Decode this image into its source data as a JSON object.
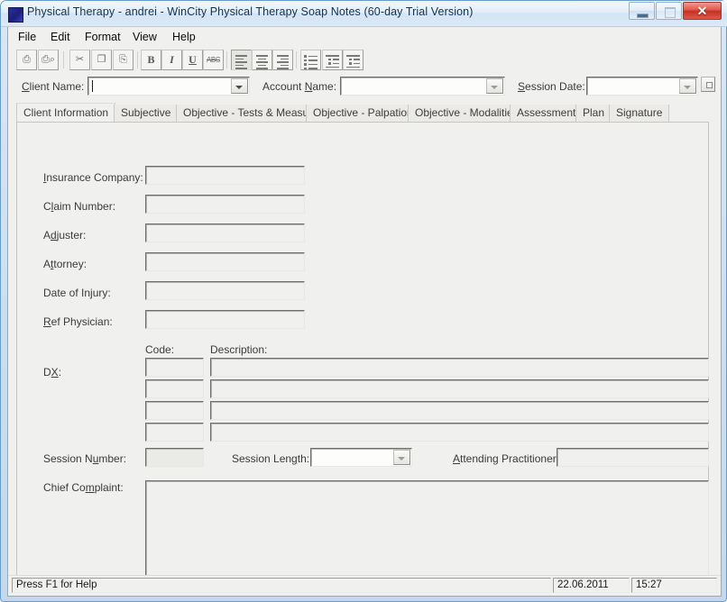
{
  "window": {
    "title": "Physical Therapy - andrei - WinCity Physical Therapy Soap Notes (60-day Trial Version)",
    "icon": "app-icon",
    "controls": {
      "minimize": "minimize-icon",
      "maximize": "maximize-icon",
      "close": "✕"
    }
  },
  "menu": {
    "items": [
      {
        "label": "File"
      },
      {
        "label": "Edit"
      },
      {
        "label": "Format"
      },
      {
        "label": "View"
      },
      {
        "label": "Help"
      }
    ]
  },
  "toolbar": {
    "buttons": [
      {
        "name": "print-icon",
        "glyph": "⎙"
      },
      {
        "name": "print-preview-icon",
        "glyph": "⌕"
      },
      {
        "name": "cut-icon",
        "glyph": "✂"
      },
      {
        "name": "copy-icon",
        "glyph": "❐"
      },
      {
        "name": "paste-icon",
        "glyph": "⎘"
      },
      {
        "name": "bold-icon",
        "glyph": "B"
      },
      {
        "name": "italic-icon",
        "glyph": "I"
      },
      {
        "name": "underline-icon",
        "glyph": "U"
      },
      {
        "name": "spellcheck-icon",
        "glyph": "ABC"
      },
      {
        "name": "align-left-icon",
        "glyph": ""
      },
      {
        "name": "align-center-icon",
        "glyph": ""
      },
      {
        "name": "align-right-icon",
        "glyph": ""
      },
      {
        "name": "bullet-list-icon",
        "glyph": ""
      },
      {
        "name": "decrease-indent-icon",
        "glyph": ""
      },
      {
        "name": "increase-indent-icon",
        "glyph": ""
      }
    ]
  },
  "top_fields": {
    "client_name": {
      "label_pre": "C",
      "label_post": "lient Name:",
      "value": "",
      "placeholder": ""
    },
    "account_name": {
      "label_pre": "Account ",
      "label_mid": "N",
      "label_post": "ame:",
      "value": "",
      "placeholder": ""
    },
    "session_date": {
      "label_pre": "S",
      "label_post": "ession Date:",
      "value": "",
      "placeholder": ""
    },
    "date_picker_button": "calendar-picker-icon"
  },
  "tabs": [
    {
      "label": "Client Information",
      "active": true
    },
    {
      "label": "Subjective",
      "active": false
    },
    {
      "label": "Objective - Tests & Measures",
      "active": false
    },
    {
      "label": "Objective - Palpation",
      "active": false
    },
    {
      "label": "Objective - Modalities",
      "active": false
    },
    {
      "label": "Assessment",
      "active": false
    },
    {
      "label": "Plan",
      "active": false
    },
    {
      "label": "Signature",
      "active": false
    }
  ],
  "form": {
    "rows": [
      {
        "pre": "",
        "acc": "I",
        "post": "nsurance Company:",
        "value": ""
      },
      {
        "pre": "C",
        "acc": "l",
        "post": "aim Number:",
        "value": ""
      },
      {
        "pre": "A",
        "acc": "d",
        "post": "juster:",
        "value": ""
      },
      {
        "pre": "A",
        "acc": "t",
        "post": "torney:",
        "value": ""
      },
      {
        "pre": "Date of Injury:",
        "acc": "",
        "post": "",
        "value": ""
      },
      {
        "pre": "",
        "acc": "R",
        "post": "ef Physician:",
        "value": ""
      }
    ],
    "dx": {
      "label_pre": "D",
      "label_acc": "X",
      "label_post": ":",
      "code_header": "Code:",
      "description_header": "Description:",
      "rows": [
        {
          "code": "",
          "description": ""
        },
        {
          "code": "",
          "description": ""
        },
        {
          "code": "",
          "description": ""
        },
        {
          "code": "",
          "description": ""
        }
      ]
    },
    "session_number": {
      "pre": "Session N",
      "acc": "u",
      "post": "mber:",
      "value": ""
    },
    "session_length": {
      "pre": "Session Len",
      "acc": "g",
      "post": "th:",
      "value": ""
    },
    "attending_practitioner": {
      "pre": "",
      "acc": "A",
      "post": "ttending Practitioner:",
      "value": ""
    },
    "chief_complaint": {
      "pre": "Chief Co",
      "acc": "m",
      "post": "plaint:",
      "value": ""
    }
  },
  "statusbar": {
    "help": "Press F1 for Help",
    "date": "22.06.2011",
    "time": "15:27"
  }
}
